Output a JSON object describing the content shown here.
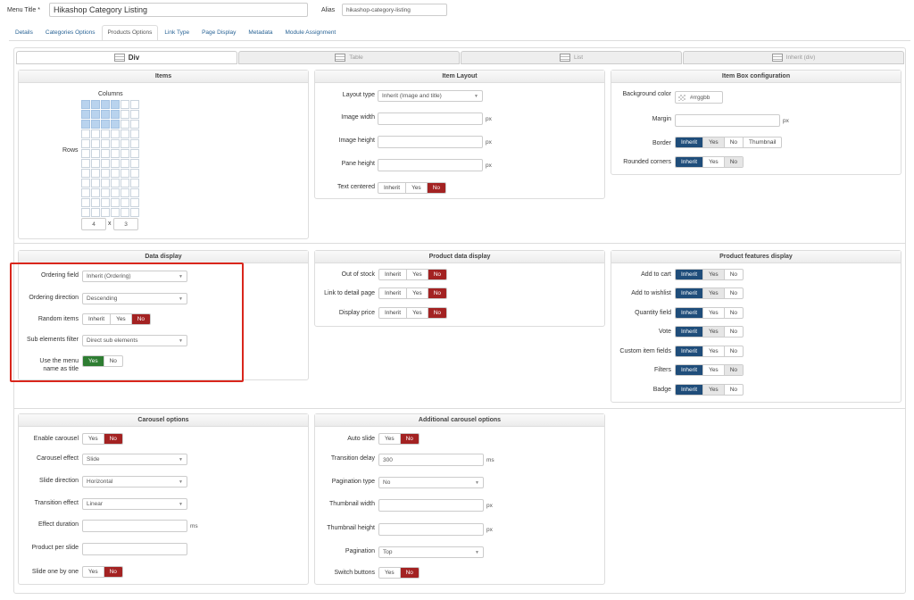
{
  "header": {
    "menu_title_label": "Menu Title *",
    "menu_title_value": "Hikashop Category Listing",
    "alias_label": "Alias",
    "alias_value": "hikashop-category-listing"
  },
  "tabs": [
    "Details",
    "Categories Options",
    "Products Options",
    "Link Type",
    "Page Display",
    "Metadata",
    "Module Assignment"
  ],
  "active_tab": "Products Options",
  "layout_tabs": [
    "Div",
    "Table",
    "List",
    "Inherit (div)"
  ],
  "items": {
    "title": "Items",
    "columns_label": "Columns",
    "rows_label": "Rows",
    "cols_value": "4",
    "x": "x",
    "rows_value": "3"
  },
  "item_layout": {
    "title": "Item Layout",
    "layout_type_label": "Layout type",
    "layout_type_value": "Inherit (Image and title)",
    "image_width_label": "Image width",
    "image_height_label": "Image height",
    "pane_height_label": "Pane height",
    "text_centered_label": "Text centered",
    "px": "px"
  },
  "item_box": {
    "title": "Item Box configuration",
    "bg_label": "Background color",
    "bg_value": "#rrggbb",
    "margin_label": "Margin",
    "border_label": "Border",
    "rounded_label": "Rounded corners"
  },
  "toggles": {
    "inherit": "Inherit",
    "yes": "Yes",
    "no": "No",
    "thumbnail": "Thumbnail"
  },
  "data_display": {
    "title": "Data display",
    "ordering_field_label": "Ordering field",
    "ordering_field_value": "Inherit (Ordering)",
    "ordering_direction_label": "Ordering direction",
    "ordering_direction_value": "Descending",
    "random_label": "Random items",
    "sub_filter_label": "Sub elements filter",
    "sub_filter_value": "Direct sub elements",
    "menu_name_label_1": "Use the menu",
    "menu_name_label_2": "name as title"
  },
  "product_data": {
    "title": "Product data display",
    "out_of_stock": "Out of stock",
    "link_detail": "Link to detail page",
    "display_price": "Display price"
  },
  "product_features": {
    "title": "Product features display",
    "add_to_cart": "Add to cart",
    "add_to_wishlist": "Add to wishlist",
    "quantity_field": "Quantity field",
    "vote": "Vote",
    "custom_fields": "Custom item fields",
    "filters": "Filters",
    "badge": "Badge"
  },
  "carousel": {
    "title": "Carousel options",
    "enable_label": "Enable carousel",
    "effect_label": "Carousel effect",
    "effect_value": "Slide",
    "direction_label": "Slide direction",
    "direction_value": "Horizontal",
    "transition_label": "Transition effect",
    "transition_value": "Linear",
    "duration_label": "Effect duration",
    "ms": "ms",
    "per_slide_label": "Product per slide",
    "one_by_one_label": "Slide one by one"
  },
  "additional": {
    "title": "Additional carousel options",
    "auto_slide": "Auto slide",
    "delay_label": "Transition delay",
    "delay_value": "300",
    "pagination_type_label": "Pagination type",
    "pagination_type_value": "No",
    "thumb_width_label": "Thumbnail width",
    "thumb_height_label": "Thumbnail height",
    "pagination_label": "Pagination",
    "pagination_value": "Top",
    "switch_label": "Switch buttons"
  },
  "colors": {
    "inherit_on": "#1f4d7a",
    "no_on": "#a32222",
    "yes_on": "#2e7d32",
    "highlight": "#d9261c"
  }
}
